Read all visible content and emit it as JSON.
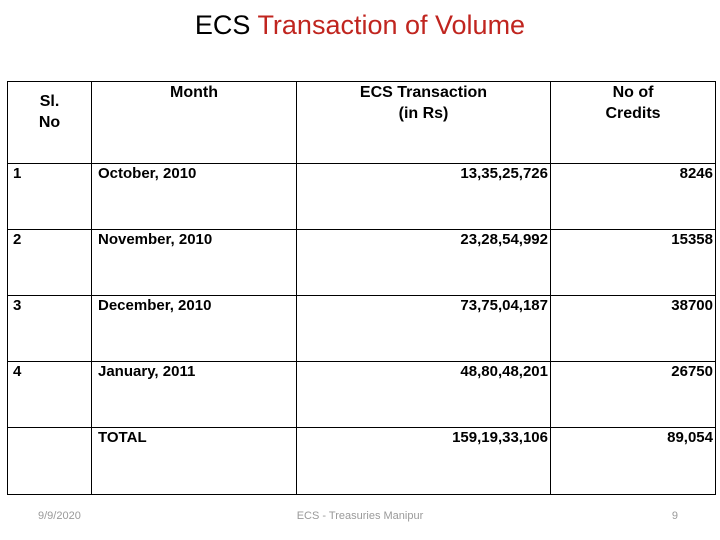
{
  "slide": {
    "title_part_black": "ECS ",
    "title_part_red": "Transaction of Volume",
    "title_color_black": "#000000",
    "title_color_red": "#C0251F"
  },
  "table": {
    "headers": [
      "Sl. No",
      "Month",
      "ECS Transaction (in Rs)",
      "No of Credits"
    ],
    "header_lines": {
      "slno_line1": "Sl.",
      "slno_line2": "No",
      "month_line1": "Month",
      "amount_line1": "ECS Transaction",
      "amount_line2": "(in Rs)",
      "credits_line1": "No of",
      "credits_line2": "Credits"
    },
    "rows": [
      {
        "slno": "1",
        "month": "October, 2010",
        "amount": "13,35,25,726",
        "credits": "8246"
      },
      {
        "slno": "2",
        "month": "November, 2010",
        "amount": "23,28,54,992",
        "credits": "15358"
      },
      {
        "slno": "3",
        "month": "December, 2010",
        "amount": "73,75,04,187",
        "credits": "38700"
      },
      {
        "slno": "4",
        "month": "January, 2011",
        "amount": "48,80,48,201",
        "credits": "26750"
      }
    ],
    "total_row": {
      "slno": "",
      "month": "TOTAL",
      "amount": "159,19,33,106",
      "credits": "89,054"
    }
  },
  "footer": {
    "date": "9/9/2020",
    "center_text": "ECS - Treasuries Manipur",
    "page_number": "9",
    "text_color": "#9a9a9a"
  }
}
